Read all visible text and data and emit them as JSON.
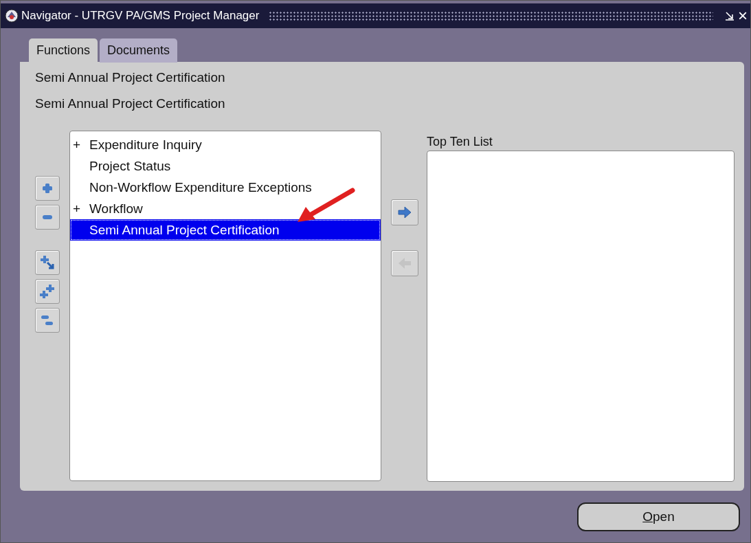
{
  "window": {
    "title": "Navigator - UTRGV PA/GMS Project Manager",
    "close": "×"
  },
  "tabs": [
    {
      "label": "Functions",
      "selected": true
    },
    {
      "label": "Documents",
      "selected": false
    }
  ],
  "headings": [
    "Semi Annual Project Certification",
    "Semi Annual Project Certification"
  ],
  "tree": {
    "items": [
      {
        "label": "Expenditure Inquiry",
        "expander": "+",
        "selected": false
      },
      {
        "label": "Project Status",
        "selected": false
      },
      {
        "label": "Non-Workflow Expenditure Exceptions",
        "selected": false
      },
      {
        "label": "Workflow",
        "expander": "+",
        "selected": false
      },
      {
        "label": "Semi Annual Project Certification",
        "selected": true
      }
    ]
  },
  "tree_buttons": [
    {
      "kind": "expand"
    },
    {
      "kind": "collapse"
    },
    {
      "kind": "expand-branch"
    },
    {
      "kind": "expand-all"
    },
    {
      "kind": "collapse-all"
    }
  ],
  "transfer_buttons": [
    {
      "kind": "add",
      "disabled": false
    },
    {
      "kind": "remove",
      "disabled": true
    }
  ],
  "top_ten": {
    "label": "Top Ten List"
  },
  "buttons": [
    {
      "label": "Open"
    }
  ]
}
